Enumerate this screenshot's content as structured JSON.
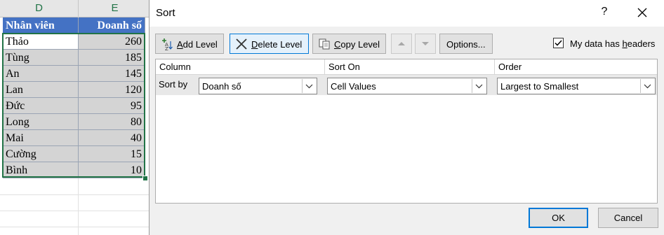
{
  "spreadsheet": {
    "columns": [
      "D",
      "E"
    ],
    "header": {
      "name": "Nhân viên",
      "value": "Doanh số"
    },
    "rows": [
      {
        "name": "Thảo",
        "value": "260"
      },
      {
        "name": "Tùng",
        "value": "185"
      },
      {
        "name": "An",
        "value": "145"
      },
      {
        "name": "Lan",
        "value": "120"
      },
      {
        "name": "Đức",
        "value": "95"
      },
      {
        "name": "Long",
        "value": "80"
      },
      {
        "name": "Mai",
        "value": "40"
      },
      {
        "name": "Cường",
        "value": "15"
      },
      {
        "name": "Bình",
        "value": "10"
      }
    ]
  },
  "dialog": {
    "title": "Sort",
    "help": "?",
    "toolbar": {
      "add_level_u": "A",
      "add_level_rest": "dd Level",
      "delete_level_u": "D",
      "delete_level_rest": "elete Level",
      "copy_level_u": "C",
      "copy_level_rest": "opy Level",
      "options": "Options..."
    },
    "headers_checkbox": {
      "label": "My data has ",
      "label_u": "h",
      "label_rest": "eaders",
      "checked": true
    },
    "grid": {
      "col_column": "Column",
      "col_sort_on": "Sort On",
      "col_order": "Order",
      "row_label": "Sort by",
      "column_value": "Doanh số",
      "sort_on_value": "Cell Values",
      "order_value": "Largest to Smallest"
    },
    "ok": "OK",
    "cancel": "Cancel"
  },
  "colors": {
    "accent": "#0078d7",
    "header_fill": "#4472c4",
    "selection": "#217346"
  }
}
